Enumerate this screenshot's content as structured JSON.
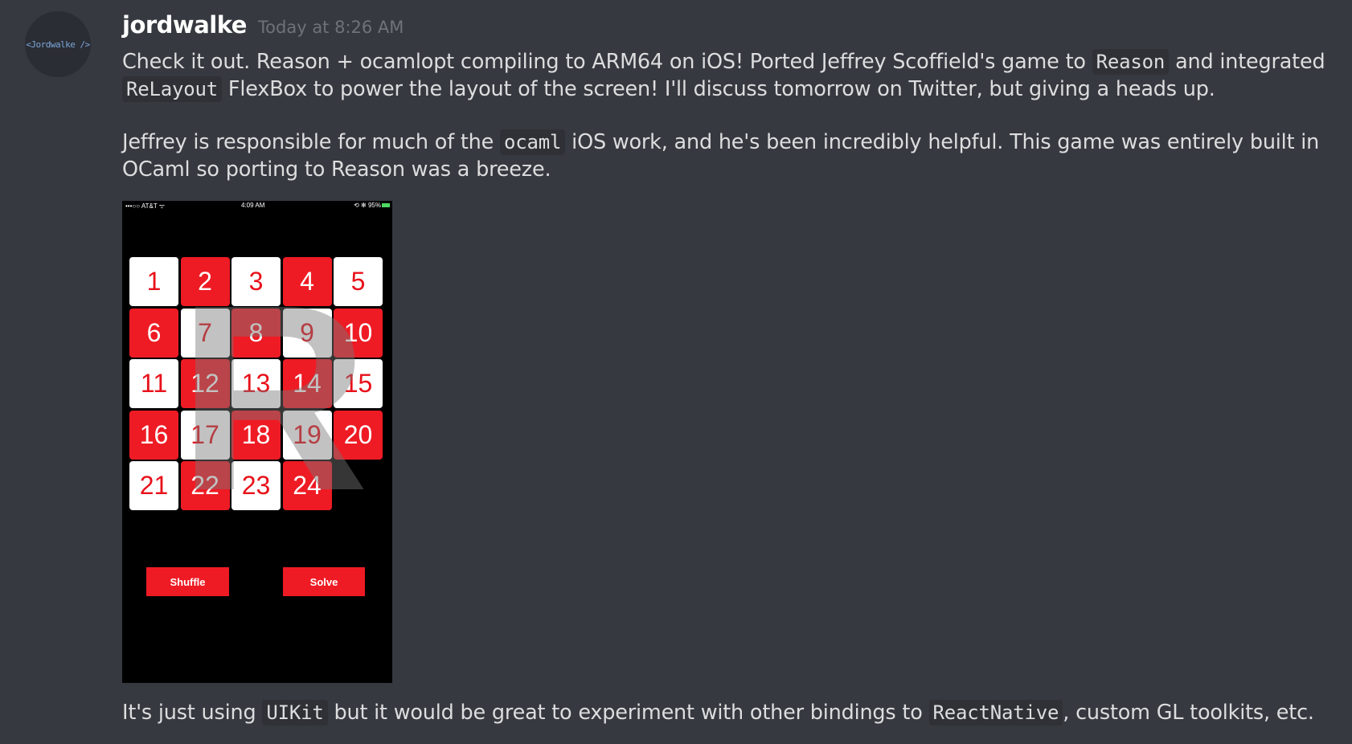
{
  "message": {
    "avatar_text": "<Jordwalke />",
    "username": "jordwalke",
    "timestamp": "Today at 8:26 AM",
    "p1": {
      "t1": "Check it out. Reason + ocamlopt compiling to ARM64 on iOS! Ported Jeffrey Scoffield's game to ",
      "c1": "Reason",
      "t2": " and integrated ",
      "c2": "ReLayout",
      "t3": " FlexBox to power the layout of the screen! I'll discuss tomorrow on Twitter, but giving a heads up."
    },
    "p2": {
      "t1": "Jeffrey is responsible for much of the ",
      "c1": "ocaml",
      "t2": " iOS work, and he's been incredibly helpful. This game was entirely built in OCaml so porting to Reason was a breeze."
    },
    "p3": {
      "t1": "It's just using ",
      "c1": "UIKit",
      "t2": " but it would be great to experiment with other bindings to ",
      "c2": "ReactNative",
      "t3": ", custom GL toolkits, etc."
    }
  },
  "attachment": {
    "status_left": "•••○○ AT&T ᯤ",
    "status_time": "4:09 AM",
    "status_right": "⟲ ✻ 95%",
    "tiles": [
      {
        "n": "1",
        "c": "white"
      },
      {
        "n": "2",
        "c": "red"
      },
      {
        "n": "3",
        "c": "white"
      },
      {
        "n": "4",
        "c": "red"
      },
      {
        "n": "5",
        "c": "white"
      },
      {
        "n": "6",
        "c": "red"
      },
      {
        "n": "7",
        "c": "white"
      },
      {
        "n": "8",
        "c": "red"
      },
      {
        "n": "9",
        "c": "white"
      },
      {
        "n": "10",
        "c": "red"
      },
      {
        "n": "11",
        "c": "white"
      },
      {
        "n": "12",
        "c": "red"
      },
      {
        "n": "13",
        "c": "white"
      },
      {
        "n": "14",
        "c": "red"
      },
      {
        "n": "15",
        "c": "white"
      },
      {
        "n": "16",
        "c": "red"
      },
      {
        "n": "17",
        "c": "white"
      },
      {
        "n": "18",
        "c": "red"
      },
      {
        "n": "19",
        "c": "white"
      },
      {
        "n": "20",
        "c": "red"
      },
      {
        "n": "21",
        "c": "white"
      },
      {
        "n": "22",
        "c": "red"
      },
      {
        "n": "23",
        "c": "white"
      },
      {
        "n": "24",
        "c": "red"
      }
    ],
    "shuffle_label": "Shuffle",
    "solve_label": "Solve"
  },
  "colors": {
    "background": "#36393f",
    "text": "#dcddde",
    "tile_red": "#ee1b24",
    "tile_white": "#ffffff"
  }
}
